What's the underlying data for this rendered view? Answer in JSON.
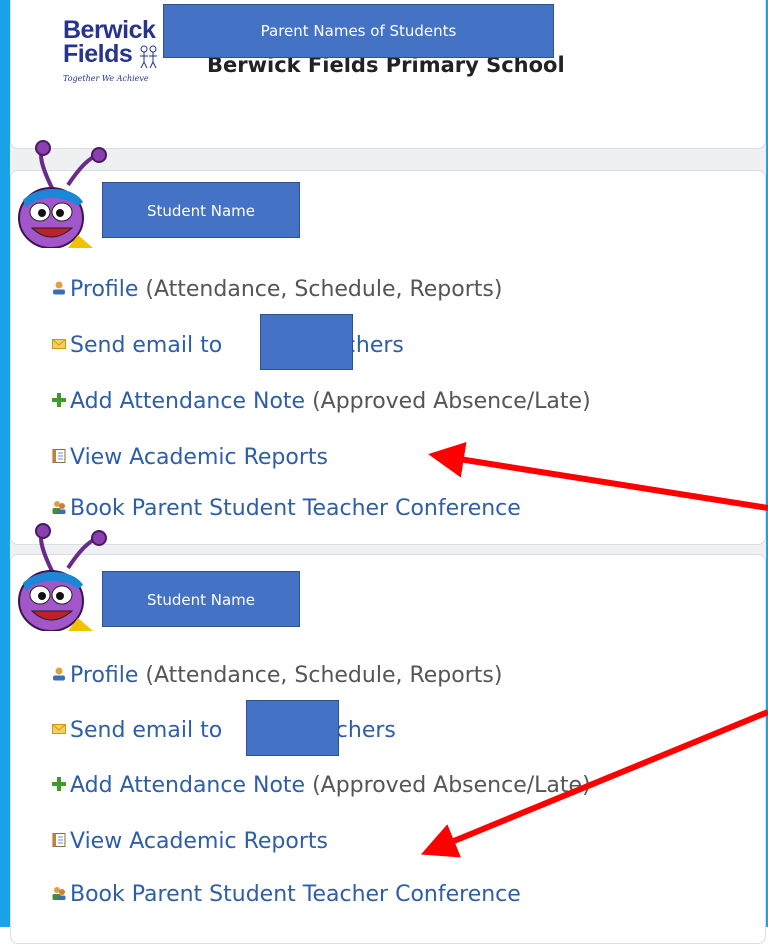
{
  "header": {
    "logo_line1": "Berwick",
    "logo_line2": "Fields",
    "logo_tagline": "Together We Achieve",
    "school_name": "Berwick Fields Primary School",
    "overlay_label": "Parent Names of Students"
  },
  "students": [
    {
      "name_overlay": "Student Name",
      "items": [
        {
          "icon": "profile-icon",
          "link": "Profile",
          "rest": " (Attendance, Schedule, Reports)"
        },
        {
          "icon": "email-icon",
          "link": "Send email to",
          "rest": "teachers"
        },
        {
          "icon": "plus-icon",
          "link": "Add Attendance Note",
          "rest": " (Approved Absence/Late)"
        },
        {
          "icon": "report-icon",
          "link": "View Academic Reports",
          "rest": ""
        },
        {
          "icon": "conference-icon",
          "link": "Book Parent Student Teacher Conference",
          "rest": ""
        }
      ]
    },
    {
      "name_overlay": "Student Name",
      "items": [
        {
          "icon": "profile-icon",
          "link": "Profile",
          "rest": " (Attendance, Schedule, Reports)"
        },
        {
          "icon": "email-icon",
          "link": "Send email to",
          "rest": "teachers"
        },
        {
          "icon": "plus-icon",
          "link": "Add Attendance Note",
          "rest": " (Approved Absence/Late)"
        },
        {
          "icon": "report-icon",
          "link": "View Academic Reports",
          "rest": ""
        },
        {
          "icon": "conference-icon",
          "link": "Book Parent Student Teacher Conference",
          "rest": ""
        }
      ]
    }
  ],
  "colors": {
    "frame": "#1aa3e8",
    "link": "#2e5ea8",
    "overlay": "#4472c4",
    "arrow": "#ff0000"
  }
}
